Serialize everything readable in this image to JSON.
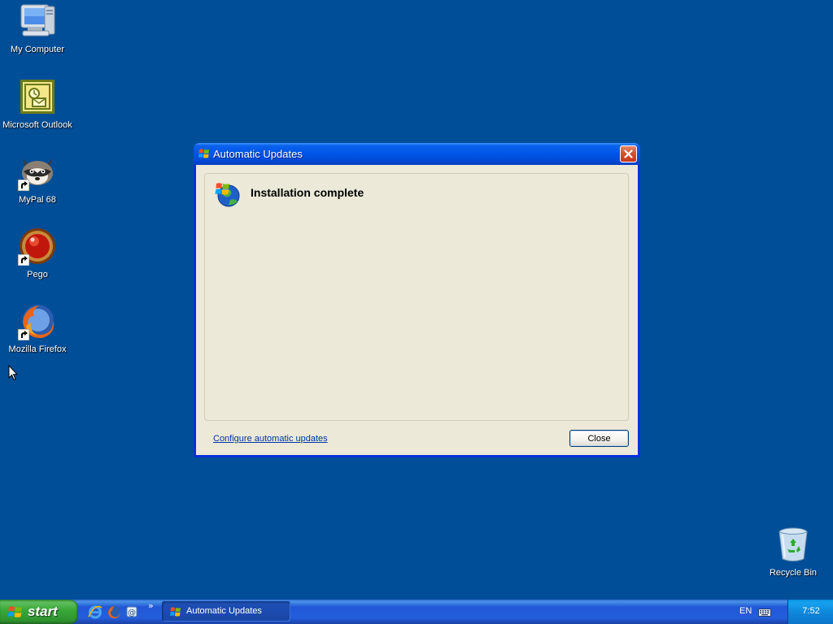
{
  "desktop": {
    "icons": [
      {
        "label": "My Computer",
        "icon": "my-computer-icon"
      },
      {
        "label": "Microsoft Outlook",
        "icon": "outlook-icon"
      },
      {
        "label": "MyPal 68",
        "icon": "mypal-icon"
      },
      {
        "label": "Pego",
        "icon": "pego-icon"
      },
      {
        "label": "Mozilla Firefox",
        "icon": "firefox-icon"
      },
      {
        "label": "Recycle Bin",
        "icon": "recycle-bin-icon"
      }
    ]
  },
  "dialog": {
    "title": "Automatic Updates",
    "heading": "Installation complete",
    "link": "Configure automatic updates",
    "close_button": "Close"
  },
  "taskbar": {
    "start_label": "start",
    "quick_launch": [
      "internet-explorer-icon",
      "firefox-icon",
      "email-icon"
    ],
    "chevron": "»",
    "tasks": [
      {
        "label": "Automatic Updates",
        "icon": "windows-update-icon",
        "active": true
      }
    ],
    "language": "EN",
    "clock": "7:52"
  },
  "colors": {
    "desktop_background": "#004e98",
    "titlebar": "#0055e6",
    "dialog_body": "#ece9d8",
    "start_button": "#37a837",
    "taskbar": "#245edb",
    "tray": "#0f89dc",
    "close_x": "#d8502f"
  }
}
